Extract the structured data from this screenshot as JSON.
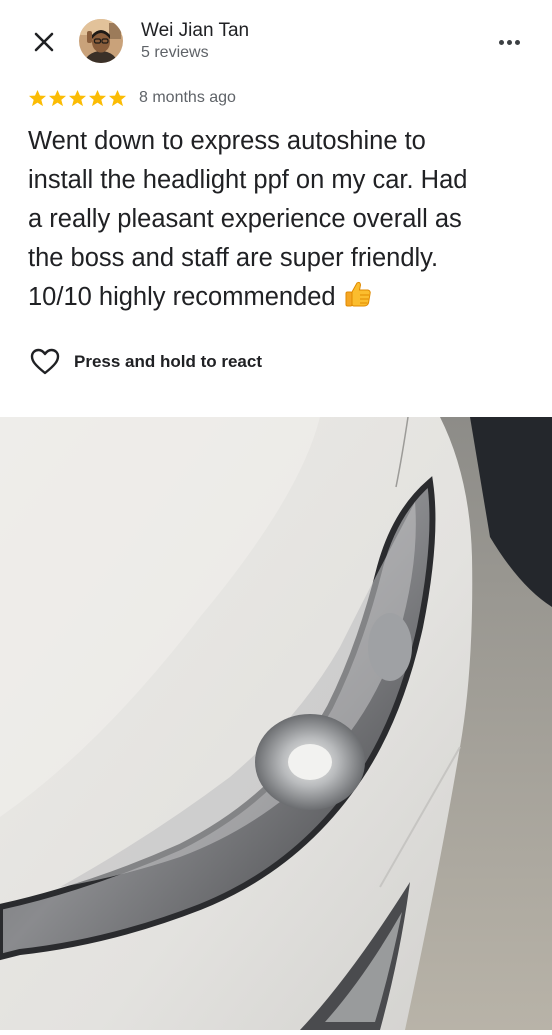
{
  "reviewer": {
    "name": "Wei Jian Tan",
    "reviews": "5 reviews"
  },
  "review": {
    "rating": 5,
    "max_rating": 5,
    "date": "8 months ago",
    "text": "Went down to express autoshine to install the headlight ppf on my car. Had a really pleasant experience overall as the boss and staff are super friendly. 10/10 highly recommended 👍",
    "line_1": "Went down to express autoshine to",
    "line_2": "install the headlight ppf on my car. Had",
    "line_3": "a really pleasant experience overall as",
    "line_4": "the boss and staff are super friendly.",
    "line_5": "10/10 highly recommended"
  },
  "actions": {
    "react_label": "Press and hold to react"
  },
  "icons": {
    "close": "close-icon",
    "more": "more-vertical-dots-icon",
    "star": "star-icon",
    "heart": "heart-outline-icon",
    "thumbs_up": "thumbs-up-emoji"
  },
  "colors": {
    "star": "#fbbc04",
    "secondary_text": "#5f6368",
    "primary_text": "#202124"
  }
}
